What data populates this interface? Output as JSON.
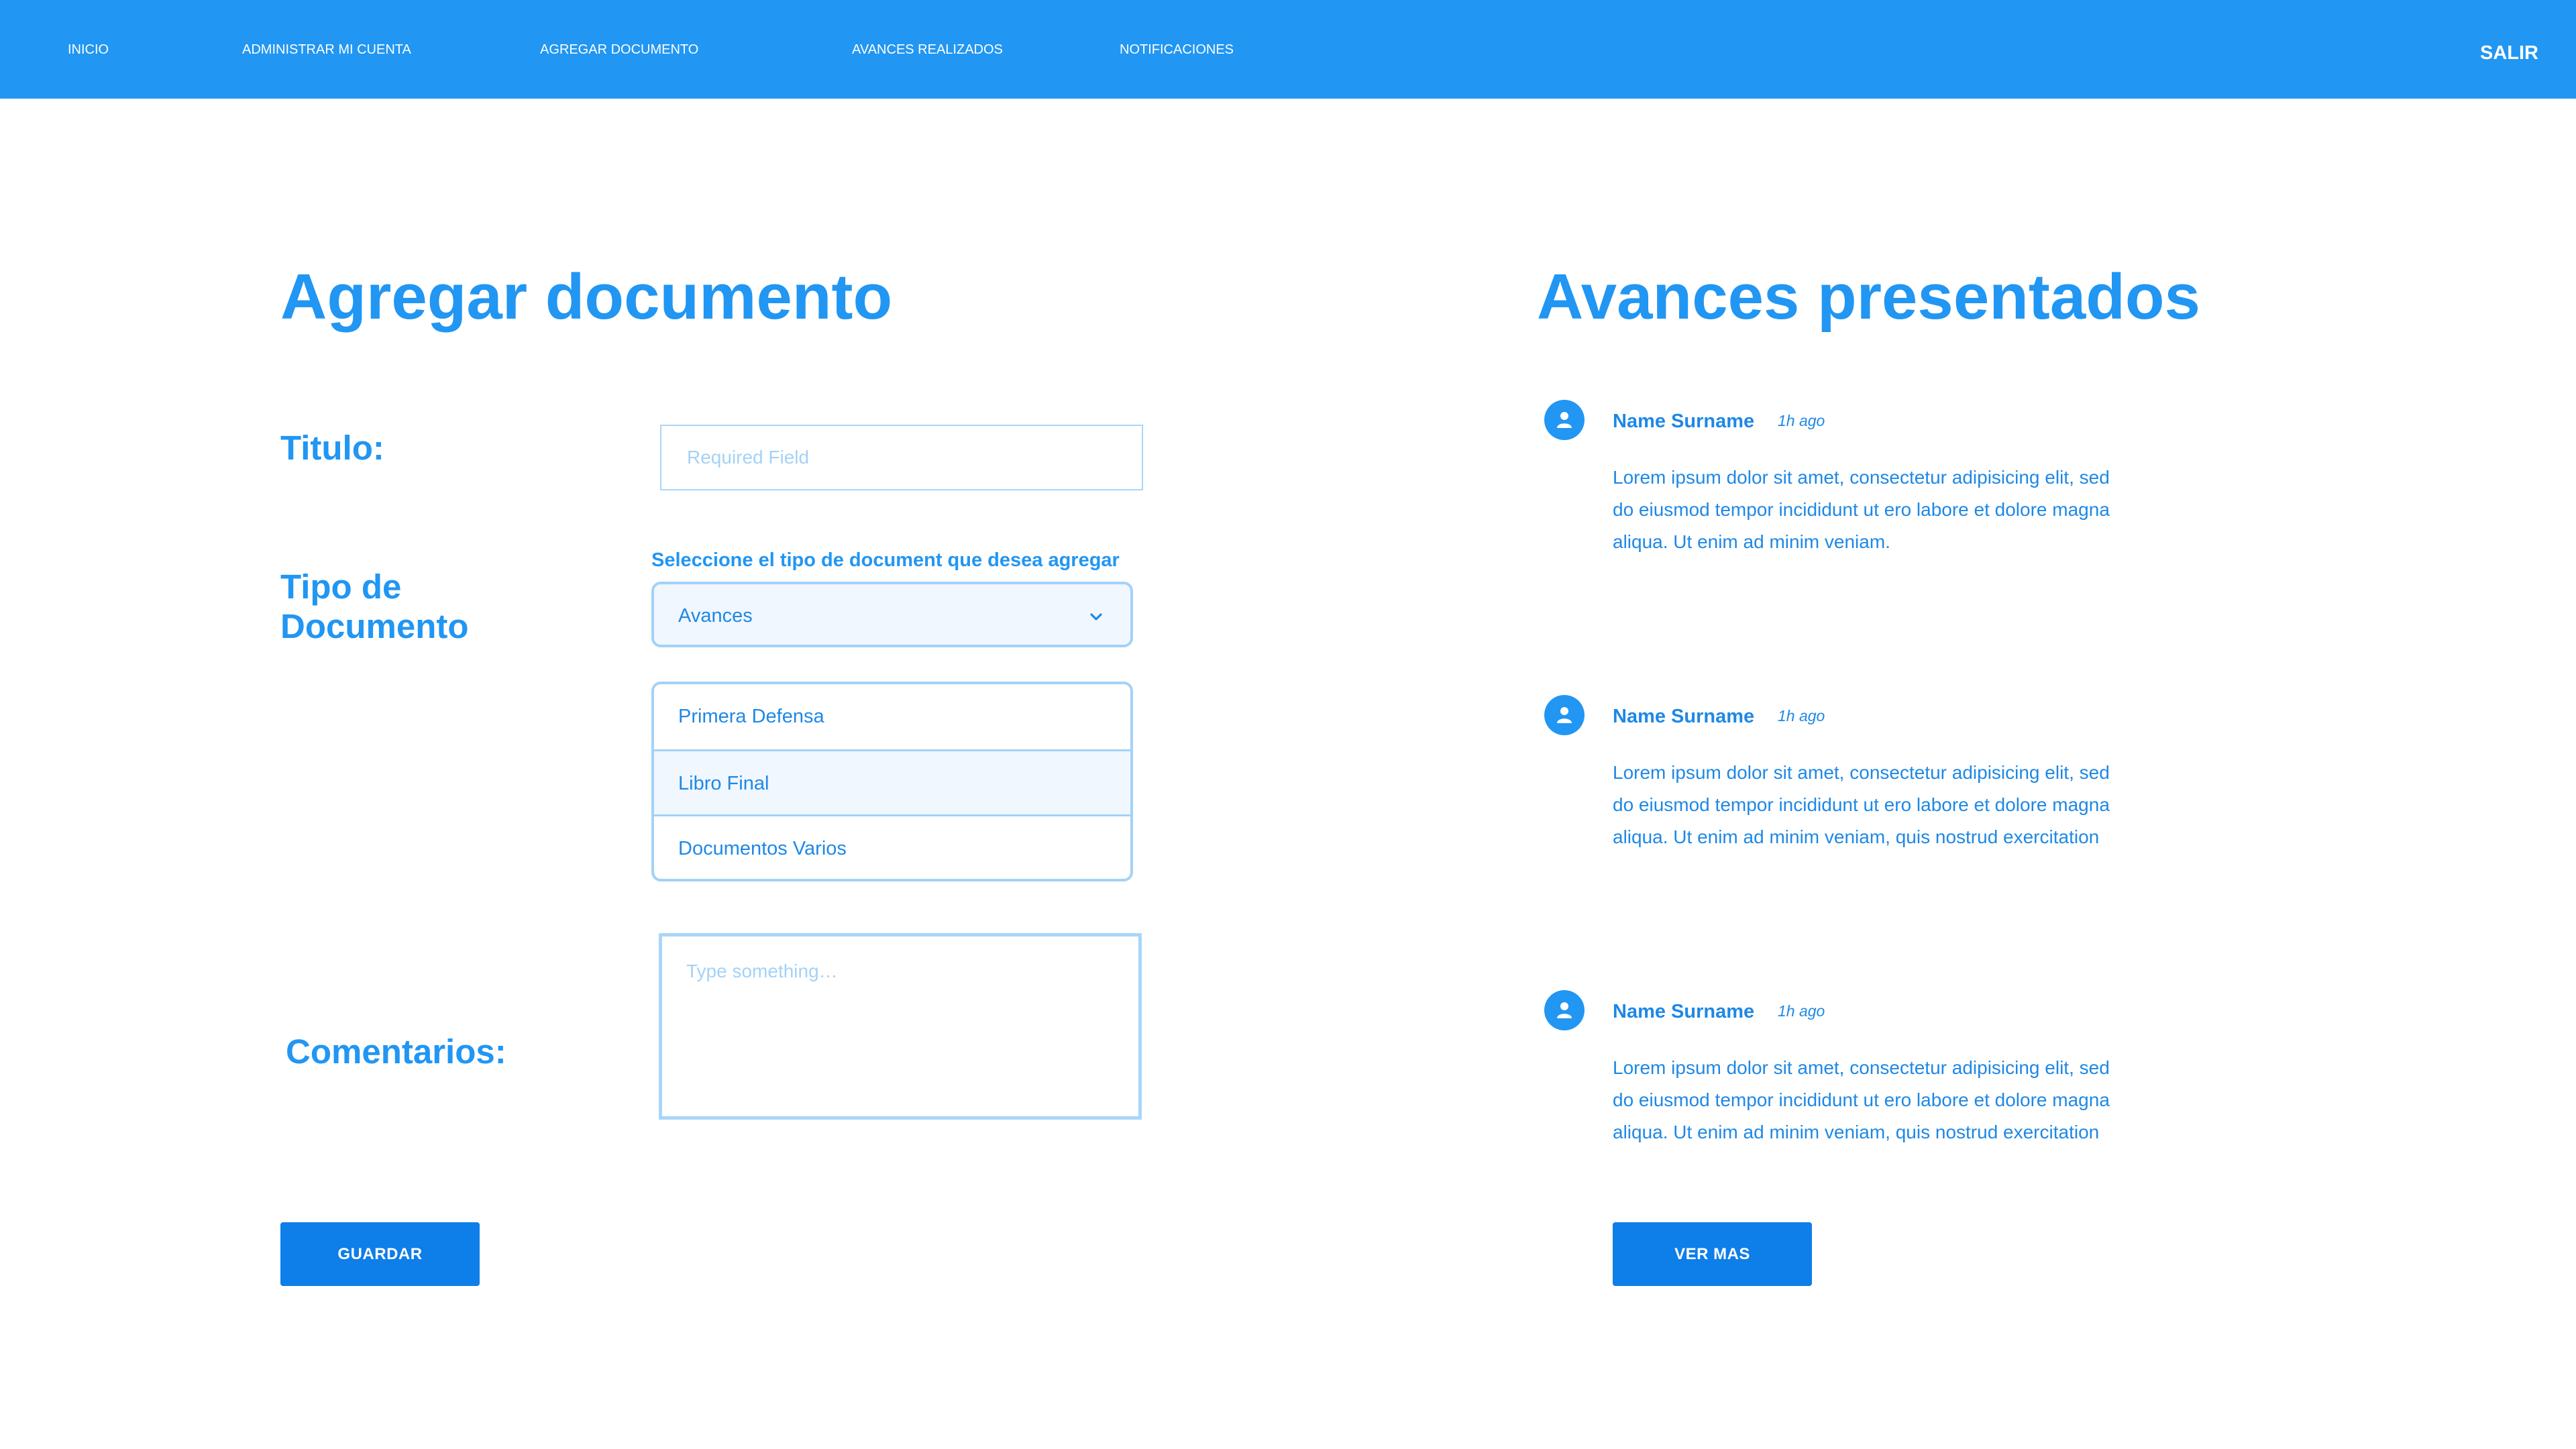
{
  "nav": {
    "items": [
      "INICIO",
      "ADMINISTRAR MI CUENTA",
      "AGREGAR DOCUMENTO",
      "AVANCES REALIZADOS",
      "NOTIFICACIONES"
    ],
    "logout": "SALIR"
  },
  "form": {
    "title": "Agregar documento",
    "titulo_label": "Titulo:",
    "titulo_placeholder": "Required Field",
    "tipo_label": "Tipo de Documento",
    "select_caption": "Seleccione el tipo de document que desea agregar",
    "select_value": "Avances",
    "options": [
      "Primera Defensa",
      "Libro Final",
      "Documentos Varios"
    ],
    "comentarios_label": "Comentarios:",
    "comentarios_placeholder": "Type something…",
    "save_label": "GUARDAR"
  },
  "feed": {
    "title": "Avances presentados",
    "posts": [
      {
        "name": "Name Surname",
        "time": "1h ago",
        "body": "Lorem ipsum dolor sit amet, consectetur adipisicing elit, sed do eiusmod tempor incididunt ut ero labore et dolore magna aliqua. Ut enim ad minim veniam."
      },
      {
        "name": "Name Surname",
        "time": "1h ago",
        "body": "Lorem ipsum dolor sit amet, consectetur adipisicing elit, sed do eiusmod tempor incididunt ut ero labore et dolore magna aliqua. Ut enim ad minim veniam, quis nostrud exercitation"
      },
      {
        "name": "Name Surname",
        "time": "1h ago",
        "body": "Lorem ipsum dolor sit amet, consectetur adipisicing elit, sed do eiusmod tempor incididunt ut ero labore et dolore magna aliqua. Ut enim ad minim veniam, quis nostrud exercitation"
      }
    ],
    "more_label": "VER MAS"
  },
  "icons": {
    "avatar": "user-avatar-icon",
    "dropdown": "chevron-down-icon"
  },
  "colors": {
    "primary": "#2196f3",
    "button": "#0e7ee8",
    "border": "#a3d2f7"
  }
}
